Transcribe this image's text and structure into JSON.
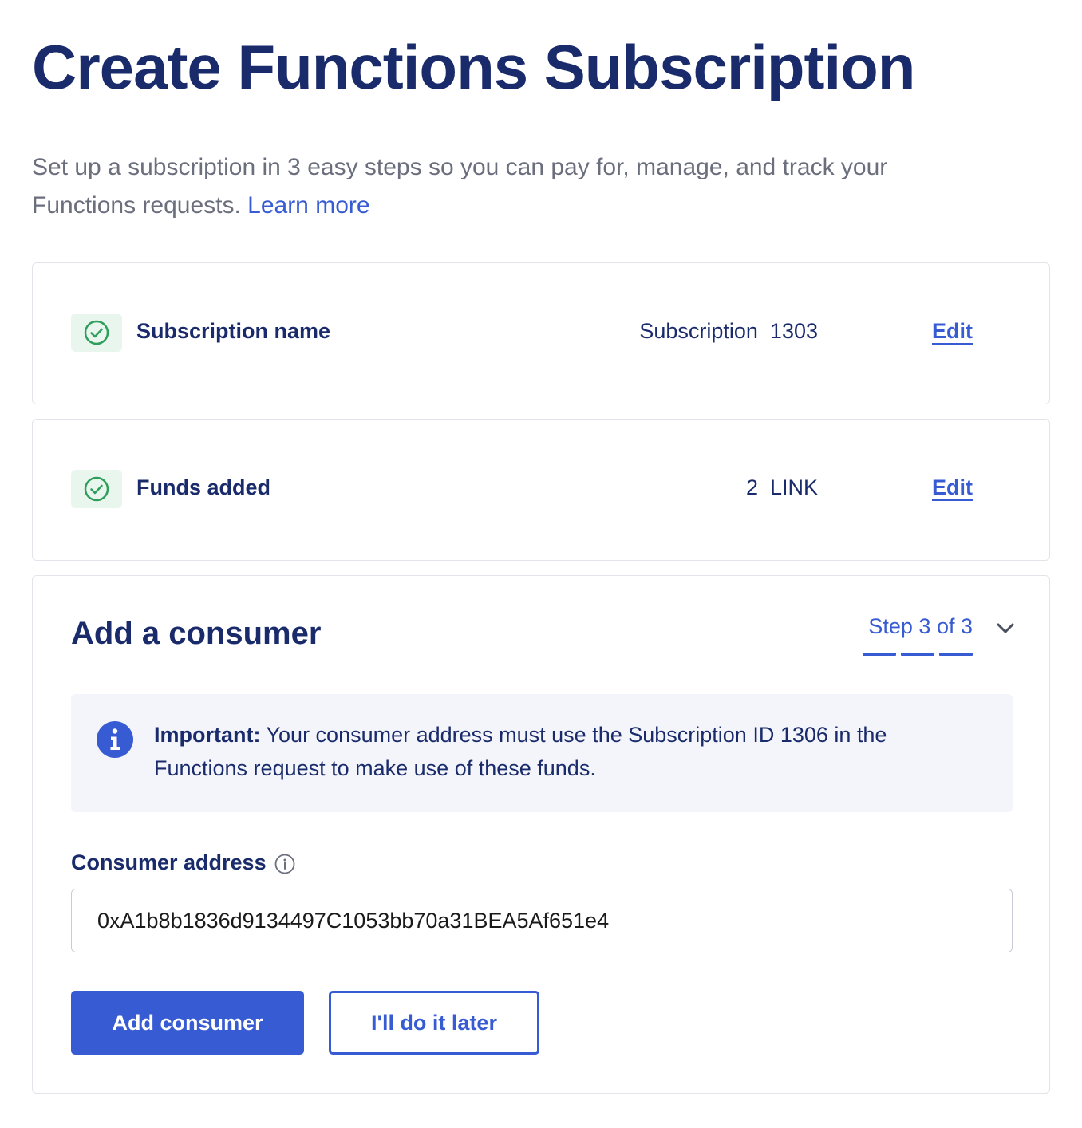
{
  "page": {
    "title": "Create Functions Subscription",
    "intro": "Set up a subscription in 3 easy steps so you can pay for, manage, and track your Functions requests.",
    "learn_more": "Learn more"
  },
  "steps": [
    {
      "label": "Subscription name",
      "value": "Subscription  1303",
      "edit_label": "Edit",
      "status_icon": "check-circle-icon"
    },
    {
      "label": "Funds added",
      "value": "2  LINK",
      "edit_label": "Edit",
      "status_icon": "check-circle-icon"
    }
  ],
  "consumer": {
    "heading": "Add a consumer",
    "step_indicator": "Step 3 of 3",
    "steps_completed": 3,
    "steps_total": 3,
    "notice_title": "Important:",
    "notice_body": "Your consumer address must use the Subscription ID 1306 in the Functions request to make use of these funds.",
    "field_label": "Consumer address",
    "address_value": "0xA1b8b1836d9134497C1053bb70a31BEA5Af651e4",
    "primary_button": "Add consumer",
    "secondary_button": "I'll do it later"
  },
  "colors": {
    "heading": "#1a2b6b",
    "accent": "#375bd2",
    "success": "#2e9e5b",
    "success_bg": "#e9f6ee",
    "muted_text": "#6b6f7d",
    "notice_bg": "#f4f5fa",
    "border": "#e2e4ea"
  }
}
